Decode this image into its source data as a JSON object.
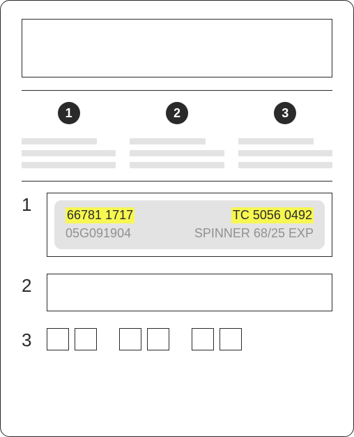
{
  "columns": [
    {
      "badge": "1"
    },
    {
      "badge": "2"
    },
    {
      "badge": "3"
    }
  ],
  "rows": {
    "r1": {
      "num": "1",
      "ticket": {
        "code_a": "66781   1717",
        "code_b": "TC 5056 0492",
        "sub_a": "05G091904",
        "sub_b": "SPINNER 68/25 EXP"
      }
    },
    "r2": {
      "num": "2"
    },
    "r3": {
      "num": "3"
    }
  }
}
